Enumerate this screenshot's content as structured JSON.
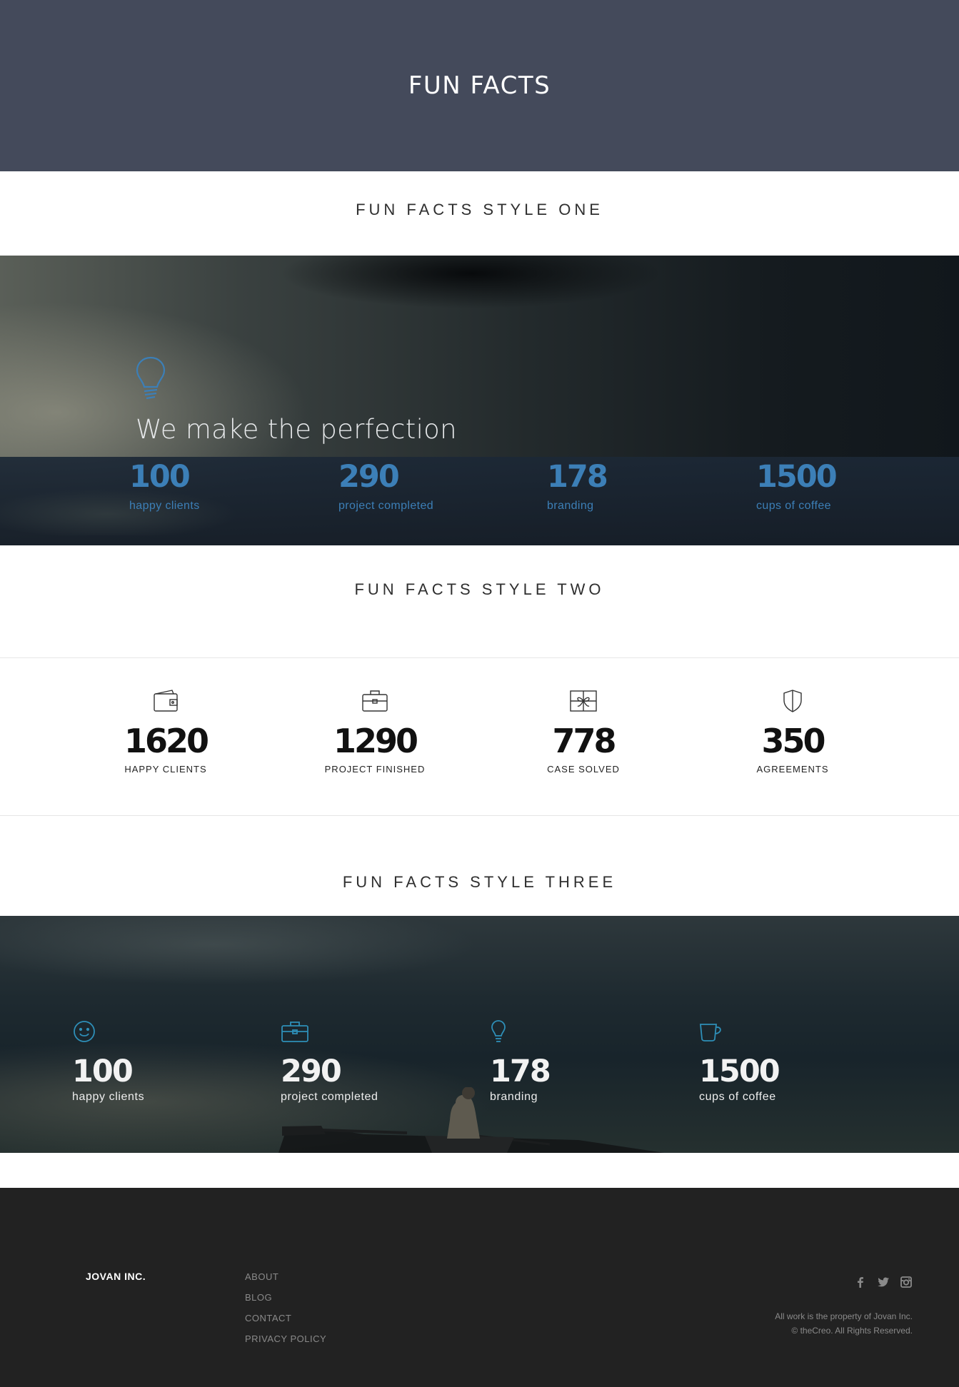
{
  "header": {
    "title": "FUN FACTS"
  },
  "style_one": {
    "title": "FUN FACTS STYLE ONE",
    "tagline": "We make the perfection",
    "stats": [
      {
        "value": "100",
        "label": "happy clients"
      },
      {
        "value": "290",
        "label": "project completed"
      },
      {
        "value": "178",
        "label": "branding"
      },
      {
        "value": "1500",
        "label": "cups of coffee"
      }
    ],
    "accent": "#3c7fb7"
  },
  "style_two": {
    "title": "FUN FACTS STYLE TWO",
    "stats": [
      {
        "value": "1620",
        "label": "HAPPY CLIENTS",
        "icon": "wallet-icon"
      },
      {
        "value": "1290",
        "label": "PROJECT FINISHED",
        "icon": "briefcase-icon"
      },
      {
        "value": "778",
        "label": "CASE SOLVED",
        "icon": "gift-icon"
      },
      {
        "value": "350",
        "label": "AGREEMENTS",
        "icon": "shield-icon"
      }
    ]
  },
  "style_three": {
    "title": "FUN FACTS STYLE THREE",
    "stats": [
      {
        "value": "100",
        "label": "happy clients",
        "icon": "smiley-icon"
      },
      {
        "value": "290",
        "label": "project completed",
        "icon": "briefcase-icon"
      },
      {
        "value": "178",
        "label": "branding",
        "icon": "lightbulb-icon"
      },
      {
        "value": "1500",
        "label": "cups of coffee",
        "icon": "coffee-cup-icon"
      }
    ],
    "icon_color": "#2e8fb8"
  },
  "footer": {
    "brand": "JOVAN INC.",
    "nav": [
      "ABOUT",
      "BLOG",
      "CONTACT",
      "PRIVACY POLICY"
    ],
    "copyright_line1": "All work is the property of Jovan Inc.",
    "copyright_line2": "© theCreo. All Rights Reserved.",
    "social": [
      "facebook-icon",
      "twitter-icon",
      "instagram-icon"
    ]
  }
}
